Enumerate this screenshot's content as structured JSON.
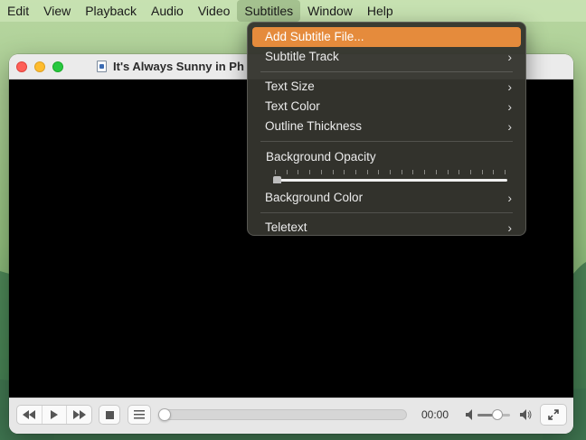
{
  "menubar": {
    "items": [
      "Edit",
      "View",
      "Playback",
      "Audio",
      "Video",
      "Subtitles",
      "Window",
      "Help"
    ],
    "active": "Subtitles"
  },
  "window": {
    "title": "It's Always Sunny in Ph"
  },
  "subtitles_menu": {
    "add_subtitle_file": "Add Subtitle File...",
    "subtitle_track": "Subtitle Track",
    "text_size": "Text Size",
    "text_color": "Text Color",
    "outline_thickness": "Outline Thickness",
    "background_opacity": "Background Opacity",
    "background_opacity_value": 0,
    "background_color": "Background Color",
    "teletext": "Teletext",
    "chevron": "›",
    "highlight_color": "#e58b3c"
  },
  "controls": {
    "time": "00:00",
    "progress": 0,
    "volume": 0.6
  },
  "icons": {
    "rewind": "rewind-icon",
    "play": "play-icon",
    "fast_forward": "fast-forward-icon",
    "stop": "stop-icon",
    "playlist": "playlist-icon",
    "volume_low": "volume-low-icon",
    "volume_high": "volume-high-icon",
    "fullscreen": "fullscreen-icon"
  }
}
